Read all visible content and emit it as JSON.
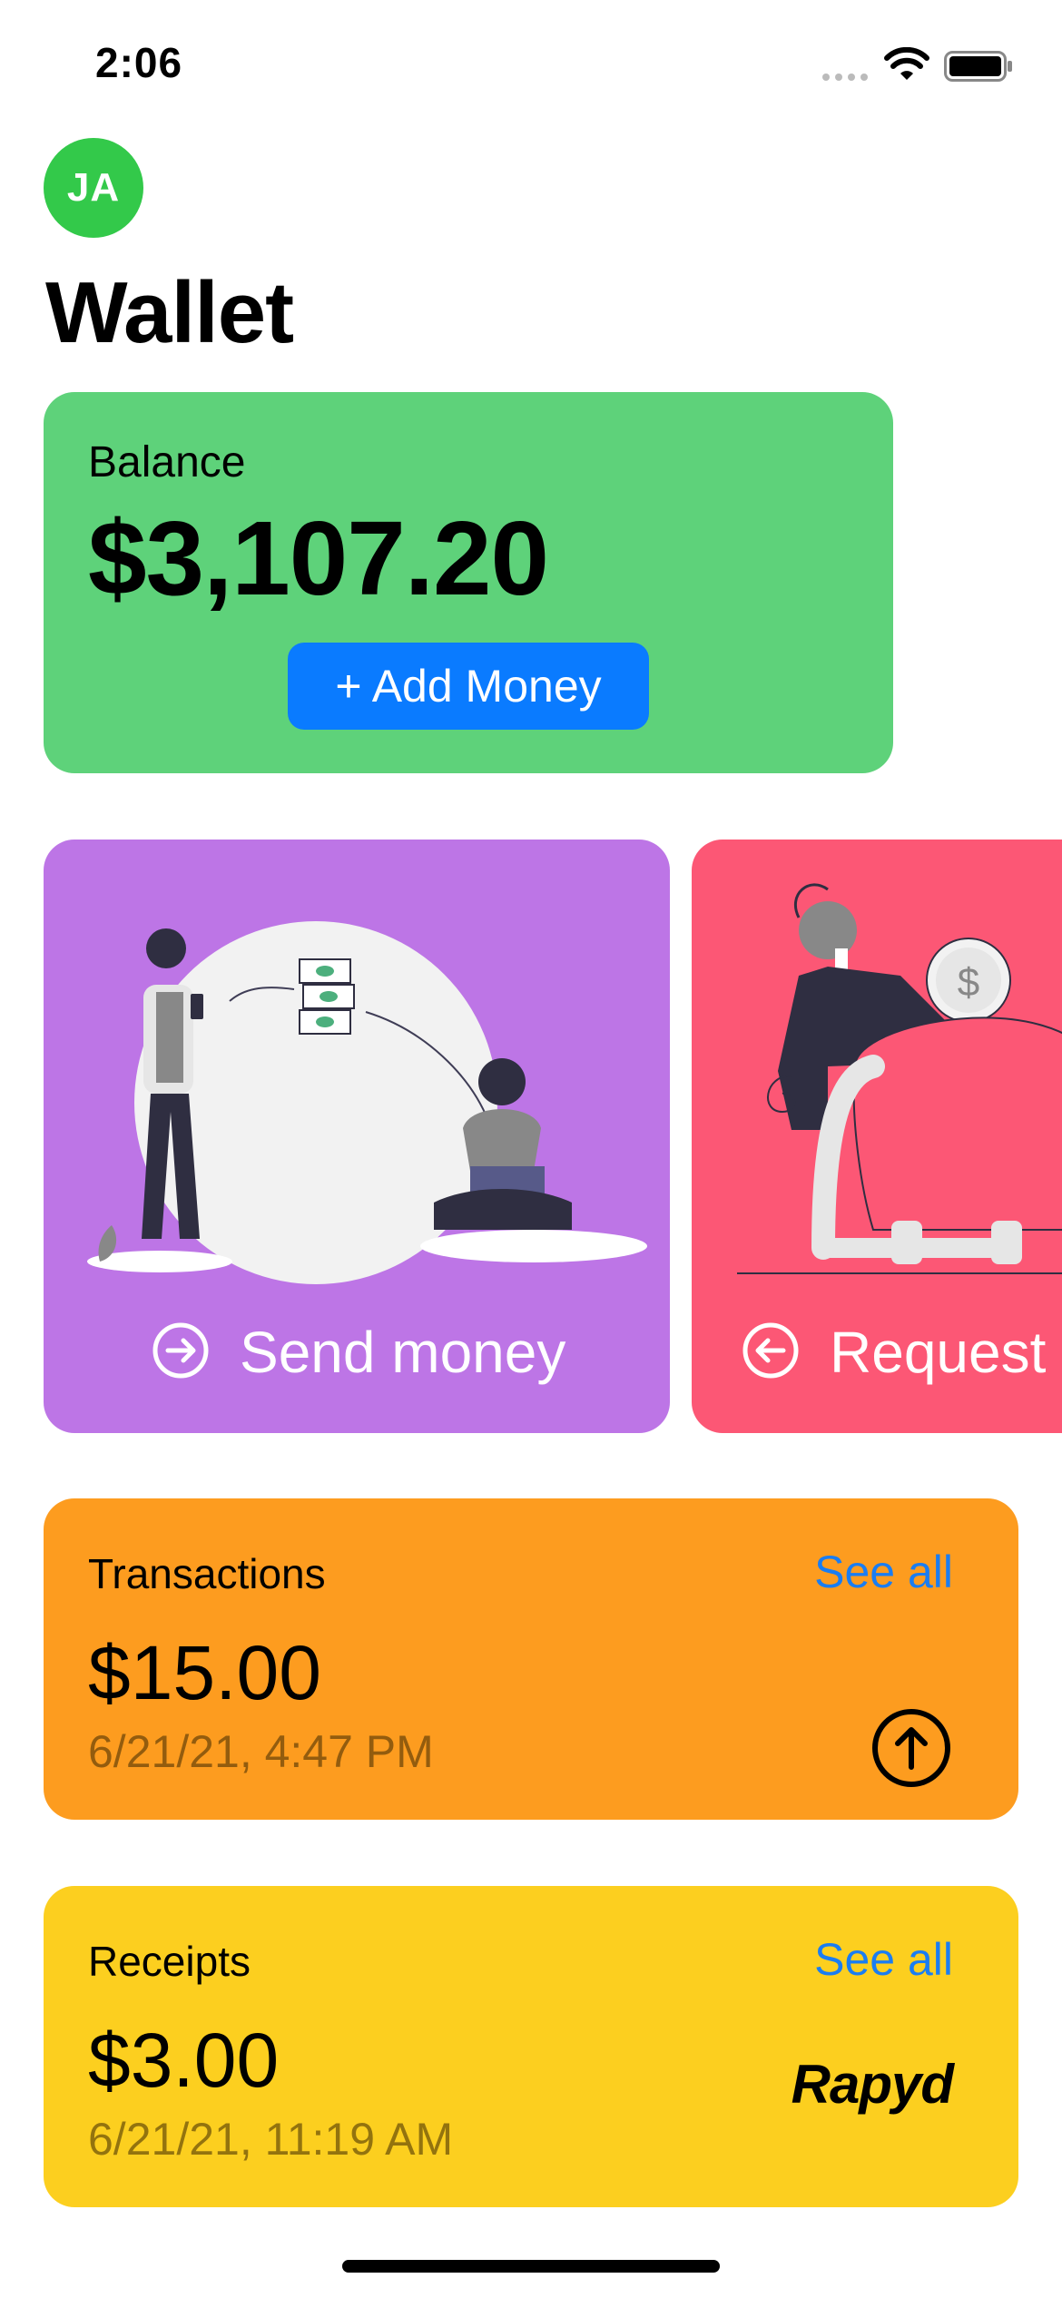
{
  "status_bar": {
    "time": "2:06"
  },
  "header": {
    "avatar_initials": "JA",
    "title": "Wallet"
  },
  "balance": {
    "label": "Balance",
    "amount": "$3,107.20",
    "add_button": "+ Add Money"
  },
  "actions": [
    {
      "label": "Send money",
      "icon": "arrow-right-circle-icon"
    },
    {
      "label": "Request money",
      "icon": "arrow-left-circle-icon"
    }
  ],
  "transactions": {
    "title": "Transactions",
    "see_all": "See all",
    "amount": "$15.00",
    "date": "6/21/21, 4:47 PM",
    "icon": "arrow-up-circle-icon"
  },
  "receipts": {
    "title": "Receipts",
    "see_all": "See all",
    "amount": "$3.00",
    "date": "6/21/21, 11:19 AM",
    "brand": "Rapyd"
  },
  "colors": {
    "avatar": "#33c94a",
    "balance_card": "#5ed27a",
    "add_button": "#0a7bff",
    "send_card": "#bd75e6",
    "request_card": "#fc5775",
    "transactions_card": "#fd9c1f",
    "receipts_card": "#fccf1f",
    "link": "#1a7df2"
  }
}
